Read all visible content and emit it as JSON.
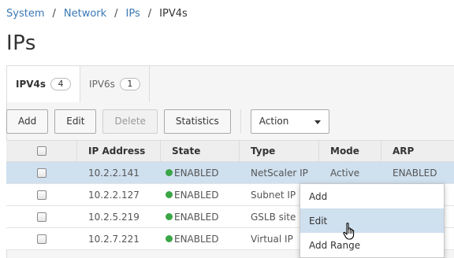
{
  "breadcrumb": {
    "items": [
      "System",
      "Network",
      "IPs"
    ],
    "current": "IPV4s",
    "separator": "/"
  },
  "page": {
    "title": "IPs"
  },
  "tabs": [
    {
      "label": "IPV4s",
      "count": "4"
    },
    {
      "label": "IPV6s",
      "count": "1"
    }
  ],
  "toolbar": {
    "add_label": "Add",
    "edit_label": "Edit",
    "delete_label": "Delete",
    "statistics_label": "Statistics",
    "action_label": "Action"
  },
  "table": {
    "columns": [
      "IP Address",
      "State",
      "Type",
      "Mode",
      "ARP"
    ],
    "rows": [
      {
        "ip": "10.2.2.141",
        "state": "ENABLED",
        "type": "NetScaler IP",
        "mode": "Active",
        "arp": "ENABLED"
      },
      {
        "ip": "10.2.2.127",
        "state": "ENABLED",
        "type": "Subnet IP",
        "mode": "",
        "arp": ""
      },
      {
        "ip": "10.2.5.219",
        "state": "ENABLED",
        "type": "GSLB site IP",
        "mode": "",
        "arp": ""
      },
      {
        "ip": "10.2.7.221",
        "state": "ENABLED",
        "type": "Virtual IP",
        "mode": "",
        "arp": ""
      }
    ]
  },
  "context_menu": {
    "items": [
      "Add",
      "Edit",
      "Add Range"
    ]
  },
  "colors": {
    "link": "#3a78b4",
    "enabled_dot": "#3aa646",
    "selection": "#cfe0ef"
  }
}
